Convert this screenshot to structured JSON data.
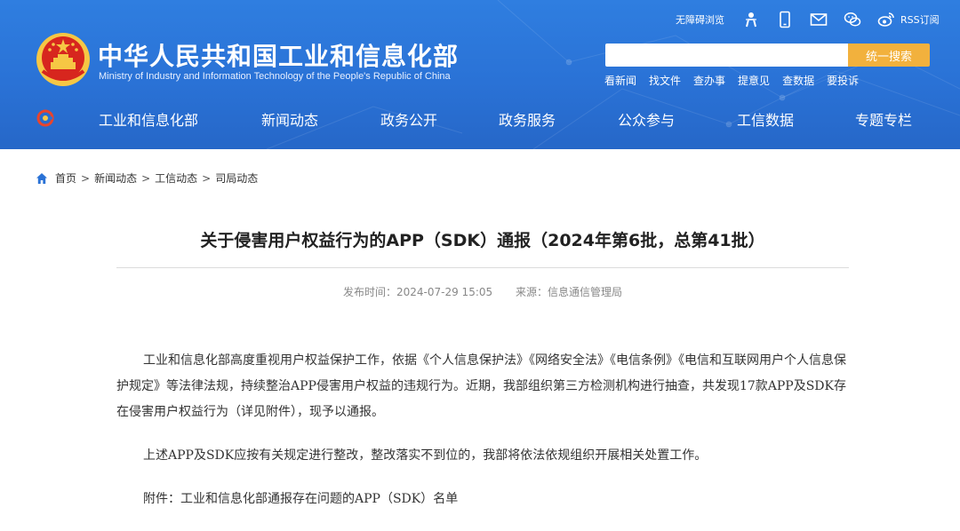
{
  "header": {
    "site_title": "中华人民共和国工业和信息化部",
    "site_subtitle": "Ministry of Industry and Information Technology of the People's Republic of China",
    "accessibility_label": "无障碍浏览",
    "rss_label": "RSS订阅",
    "search": {
      "placeholder": "",
      "button_label": "统一搜索"
    },
    "quick_links": [
      "看新闻",
      "找文件",
      "查办事",
      "提意见",
      "查数据",
      "要投诉"
    ]
  },
  "nav": {
    "items": [
      "工业和信息化部",
      "新闻动态",
      "政务公开",
      "政务服务",
      "公众参与",
      "工信数据",
      "专题专栏"
    ]
  },
  "breadcrumb": {
    "items": [
      "首页",
      "新闻动态",
      "工信动态",
      "司局动态"
    ],
    "separator": ">"
  },
  "article": {
    "title": "关于侵害用户权益行为的APP（SDK）通报（2024年第6批，总第41批）",
    "publish_time": "发布时间：2024-07-29 15:05",
    "source": "来源：信息通信管理局",
    "paragraphs": [
      "工业和信息化部高度重视用户权益保护工作，依据《个人信息保护法》《网络安全法》《电信条例》《电信和互联网用户个人信息保护规定》等法律法规，持续整治APP侵害用户权益的违规行为。近期，我部组织第三方检测机构进行抽查，共发现17款APP及SDK存在侵害用户权益行为（详见附件），现予以通报。",
      "上述APP及SDK应按有关规定进行整改，整改落实不到位的，我部将依法依规组织开展相关处置工作。",
      "附件：工业和信息化部通报存在问题的APP（SDK）名单"
    ]
  },
  "colors": {
    "header_blue": "#2a72d6",
    "search_button": "#f2b13d",
    "emblem_red": "#d7261e",
    "emblem_gold": "#f6c744"
  }
}
